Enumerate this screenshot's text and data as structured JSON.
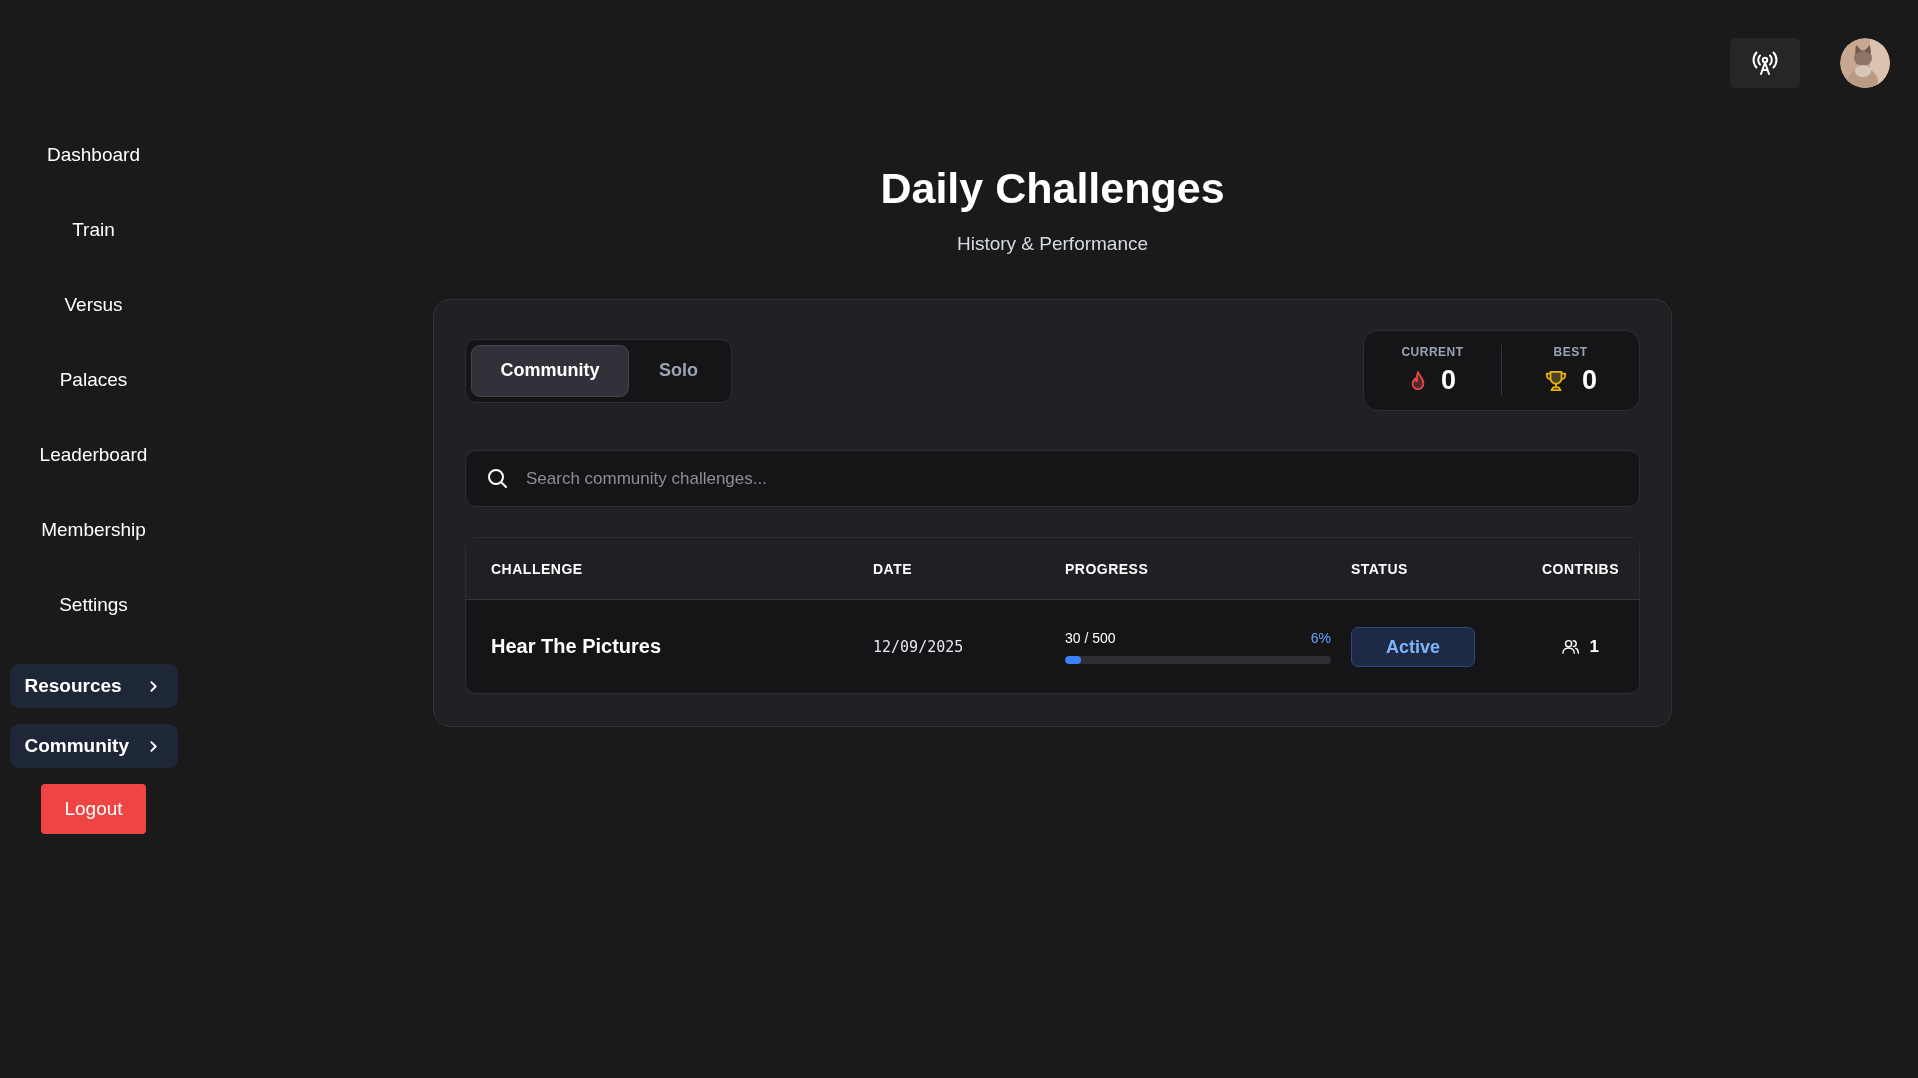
{
  "sidebar": {
    "items": [
      {
        "label": "Dashboard",
        "kind": "link"
      },
      {
        "label": "Train",
        "kind": "link"
      },
      {
        "label": "Versus",
        "kind": "link"
      },
      {
        "label": "Palaces",
        "kind": "link"
      },
      {
        "label": "Leaderboard",
        "kind": "link"
      },
      {
        "label": "Membership",
        "kind": "link"
      },
      {
        "label": "Settings",
        "kind": "link"
      },
      {
        "label": "Resources",
        "kind": "group",
        "expanded": false
      },
      {
        "label": "Community",
        "kind": "group",
        "expanded": false
      },
      {
        "label": "Logout",
        "kind": "danger"
      }
    ]
  },
  "header": {
    "title": "Daily Challenges",
    "subtitle": "History & Performance"
  },
  "tabs": [
    {
      "label": "Community",
      "selected": true
    },
    {
      "label": "Solo",
      "selected": false
    }
  ],
  "streaks": [
    {
      "label": "CURRENT",
      "value": "0",
      "kind": "flame"
    },
    {
      "label": "BEST",
      "value": "0",
      "kind": "trophy"
    }
  ],
  "search": {
    "placeholder": "Search community challenges..."
  },
  "table": {
    "columns": [
      "CHALLENGE",
      "DATE",
      "PROGRESS",
      "STATUS",
      "CONTRIBS"
    ],
    "rows": [
      {
        "challenge": "Hear The Pictures",
        "date": "12/09/2025",
        "progress": "30 / 500",
        "percent": "6%",
        "level": 0.06,
        "status": {
          "label": "Active",
          "kind": "active"
        },
        "contribs": "1"
      }
    ]
  }
}
